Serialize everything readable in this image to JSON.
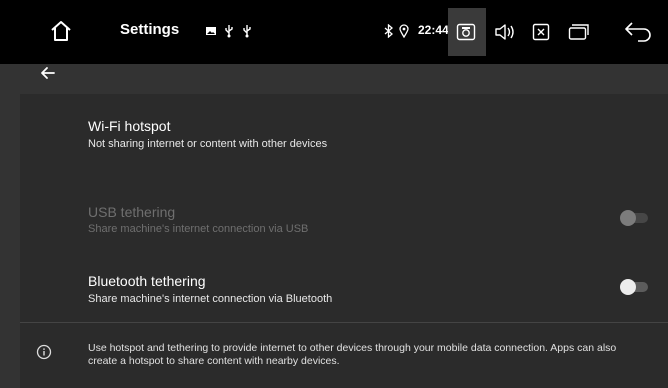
{
  "statusbar": {
    "title": "Settings",
    "time": "22:44",
    "icons": {
      "home": "home-icon",
      "notifications": [
        "gallery-icon",
        "usb-icon",
        "usb-icon"
      ],
      "bluetooth": "bluetooth-icon",
      "location": "location-icon",
      "screenshot": "screenshot-icon",
      "volume": "volume-icon",
      "close": "close-app-icon",
      "recents": "recents-icon",
      "back": "back-icon"
    }
  },
  "appbar": {
    "back_icon": "arrow-back-icon"
  },
  "settings": {
    "wifi_hotspot": {
      "title": "Wi-Fi hotspot",
      "subtitle": "Not sharing internet or content with other devices"
    },
    "usb_tethering": {
      "title": "USB tethering",
      "subtitle": "Share machine's internet connection via USB",
      "enabled": false,
      "checked": false
    },
    "bluetooth_tethering": {
      "title": "Bluetooth tethering",
      "subtitle": "Share machine's internet connection via Bluetooth",
      "enabled": true,
      "checked": false
    }
  },
  "footer": {
    "icon": "info-icon",
    "text": "Use hotspot and tethering to provide internet to other devices through your mobile data connection. Apps can also create a hotspot to share content with nearby devices."
  },
  "colors": {
    "statusbar_bg": "#000000",
    "appbar_bg": "#333333",
    "content_bg": "#2b2b2b",
    "text_primary": "#ffffff",
    "text_disabled": "#6f6f6f"
  }
}
